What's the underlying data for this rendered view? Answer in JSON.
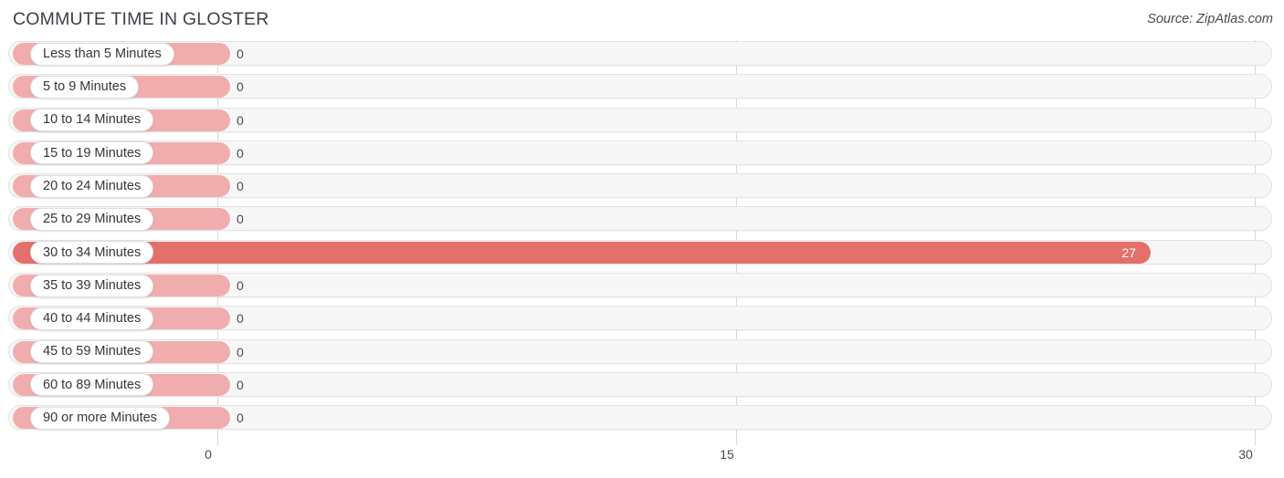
{
  "header": {
    "title": "COMMUTE TIME IN GLOSTER",
    "source": "Source: ZipAtlas.com"
  },
  "colors": {
    "bar_light": "#f1adad",
    "bar_strong": "#e4706b",
    "track": "#f7f7f7",
    "grid": "#d9d9d9",
    "title": "#3d4149"
  },
  "chart_data": {
    "type": "bar",
    "orientation": "horizontal",
    "title": "COMMUTE TIME IN GLOSTER",
    "xlabel": "",
    "ylabel": "",
    "xlim": [
      0,
      30
    ],
    "xticks": [
      "0",
      "15",
      "30"
    ],
    "grid": true,
    "legend": null,
    "categories": [
      "Less than 5 Minutes",
      "5 to 9 Minutes",
      "10 to 14 Minutes",
      "15 to 19 Minutes",
      "20 to 24 Minutes",
      "25 to 29 Minutes",
      "30 to 34 Minutes",
      "35 to 39 Minutes",
      "40 to 44 Minutes",
      "45 to 59 Minutes",
      "60 to 89 Minutes",
      "90 or more Minutes"
    ],
    "values": [
      0,
      0,
      0,
      0,
      0,
      0,
      27,
      0,
      0,
      0,
      0,
      0
    ],
    "value_labels": [
      "0",
      "0",
      "0",
      "0",
      "0",
      "0",
      "27",
      "0",
      "0",
      "0",
      "0",
      "0"
    ],
    "highlight_index": 6
  }
}
